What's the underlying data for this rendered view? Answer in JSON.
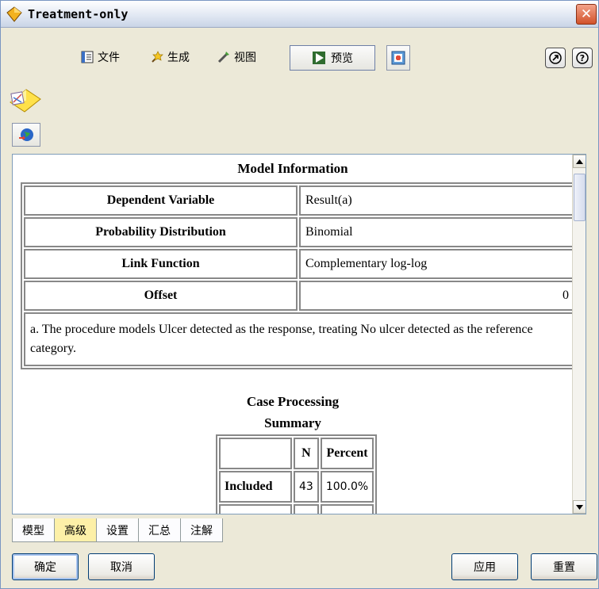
{
  "window": {
    "title": "Treatment-only",
    "close_label": "✕"
  },
  "toolbar": {
    "menu": [
      {
        "label": "文件",
        "icon": "file-icon"
      },
      {
        "label": "生成",
        "icon": "generate-icon"
      },
      {
        "label": "视图",
        "icon": "view-icon"
      }
    ],
    "preview_label": "预览"
  },
  "model_information": {
    "title": "Model Information",
    "rows": [
      {
        "label": "Dependent Variable",
        "value": "Result(a)"
      },
      {
        "label": "Probability Distribution",
        "value": "Binomial"
      },
      {
        "label": "Link Function",
        "value": "Complementary log-log"
      },
      {
        "label": "Offset",
        "value": "0"
      }
    ],
    "footnote": "a. The procedure models Ulcer detected as the response, treating No ulcer detected as the reference category."
  },
  "case_processing": {
    "title_line1": "Case Processing",
    "title_line2": "Summary",
    "headers": [
      "",
      "N",
      "Percent"
    ],
    "rows": [
      {
        "label": "Included",
        "n": "43",
        "percent": "100.0%"
      }
    ]
  },
  "tabs": [
    {
      "label": "模型",
      "active": false
    },
    {
      "label": "高级",
      "active": true
    },
    {
      "label": "设置",
      "active": false
    },
    {
      "label": "汇总",
      "active": false
    },
    {
      "label": "注解",
      "active": false
    }
  ],
  "buttons": {
    "ok": "确定",
    "cancel": "取消",
    "apply": "应用",
    "reset": "重置"
  },
  "colors": {
    "active_tab": "#fdf0a8",
    "title_bar": "#dfe6f2",
    "border": "#7f9db9"
  }
}
